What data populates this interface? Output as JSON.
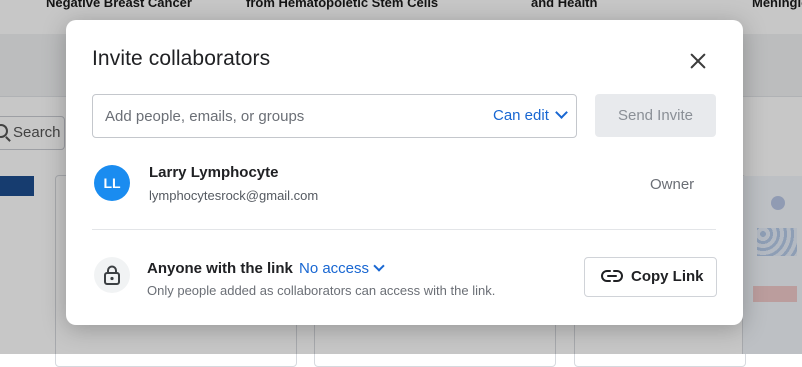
{
  "background": {
    "top_labels": [
      "Negative Breast Cancer",
      "from Hematopoietic Stem Cells",
      "and Health",
      "Meningic"
    ],
    "search_label": "Search"
  },
  "modal": {
    "title": "Invite collaborators",
    "input_placeholder": "Add people, emails, or groups",
    "permission": "Can edit",
    "send_label": "Send Invite",
    "owner": {
      "initials": "LL",
      "name": "Larry Lymphocyte",
      "email": "lymphocytesrock@gmail.com",
      "role": "Owner"
    },
    "link_sharing": {
      "title": "Anyone with the link",
      "access": "No access",
      "description": "Only people added as collaborators can access with the link.",
      "copy_label": "Copy Link"
    }
  },
  "colors": {
    "accent": "#1967d2",
    "avatar": "#1a8cf0",
    "overlay": "rgba(0,0,0,0.22)"
  },
  "icons": [
    "close-icon",
    "chevron-down-icon",
    "lock-icon",
    "link-icon",
    "search-icon"
  ]
}
